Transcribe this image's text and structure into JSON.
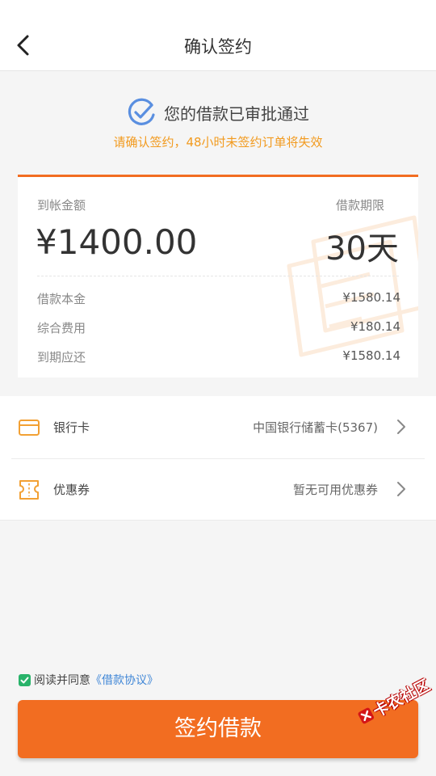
{
  "header": {
    "title": "确认签约"
  },
  "approval": {
    "message": "您的借款已审批通过",
    "note": "请确认签约，48小时未签约订单将失效"
  },
  "amount_card": {
    "received_label": "到帐金额",
    "received_amount": "¥1400.00",
    "term_label": "借款期限",
    "term_value": "30天",
    "details": [
      {
        "label": "借款本金",
        "value": "¥1580.14"
      },
      {
        "label": "综合费用",
        "value": "¥180.14"
      },
      {
        "label": "到期应还",
        "value": "¥1580.14"
      }
    ]
  },
  "options": [
    {
      "label": "银行卡",
      "value": "中国银行储蓄卡(5367)",
      "icon": "bank-card-icon"
    },
    {
      "label": "优惠券",
      "value": "暂无可用优惠券",
      "icon": "coupon-icon"
    }
  ],
  "agreement": {
    "checked": true,
    "text": "阅读并同意",
    "link": "《借款协议》"
  },
  "sign_button": {
    "label": "签约借款"
  },
  "stamp": {
    "text": "卡农社区"
  },
  "colors": {
    "accent": "#f26d21",
    "note": "#f29a1e",
    "link": "#3f86d6",
    "check": "#29b36a"
  }
}
